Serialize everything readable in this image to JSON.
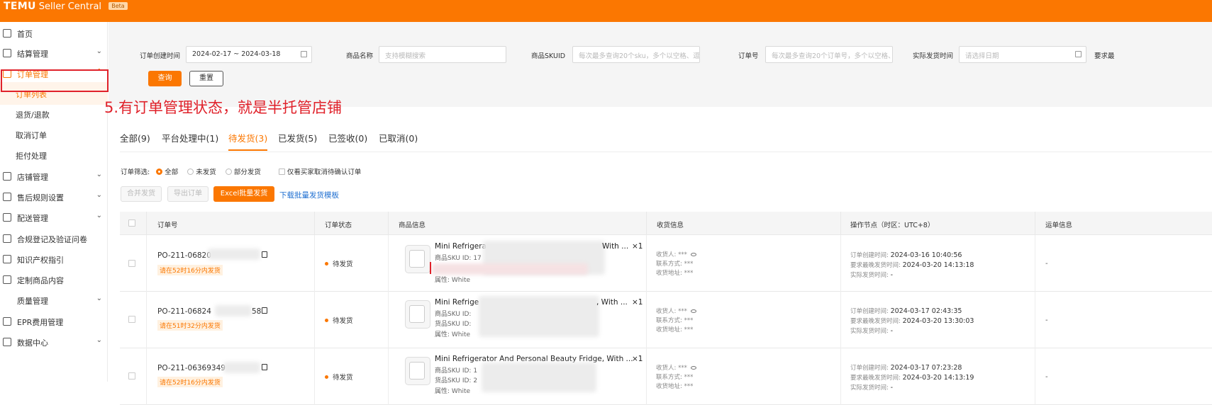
{
  "topbar": {
    "logo": "TEMU",
    "app_name": "Seller Central",
    "beta_badge": "Beta"
  },
  "sidebar": {
    "items": [
      {
        "label": "首页",
        "icon": "home-icon",
        "has_chevron": false
      },
      {
        "label": "结算管理",
        "icon": "wallet-icon",
        "has_chevron": true,
        "chevron": "⌄"
      },
      {
        "label": "订单管理",
        "icon": "order-icon",
        "has_chevron": true,
        "chevron": "⌃",
        "active": true
      },
      {
        "label": "店铺管理",
        "icon": "store-icon",
        "has_chevron": true,
        "chevron": "⌄"
      },
      {
        "label": "售后规则设置",
        "icon": "aftersale-icon",
        "has_chevron": true,
        "chevron": "⌄"
      },
      {
        "label": "配送管理",
        "icon": "truck-icon",
        "has_chevron": true,
        "chevron": "⌄"
      },
      {
        "label": "合规登记及验证问卷",
        "icon": "compliance-icon",
        "has_chevron": false
      },
      {
        "label": "知识产权指引",
        "icon": "ip-icon",
        "has_chevron": false
      },
      {
        "label": "定制商品内容",
        "icon": "custom-icon",
        "has_chevron": false
      },
      {
        "label": "质量管理",
        "icon": "",
        "has_chevron": true,
        "chevron": "⌄"
      },
      {
        "label": "EPR费用管理",
        "icon": "epr-icon",
        "has_chevron": false
      },
      {
        "label": "数据中心",
        "icon": "data-icon",
        "has_chevron": true,
        "chevron": "⌄"
      }
    ],
    "subitems": [
      {
        "label": "订单列表",
        "active": true
      },
      {
        "label": "退货/退款"
      },
      {
        "label": "取消订单"
      },
      {
        "label": "拒付处理"
      }
    ]
  },
  "filters": {
    "create_time_label": "订单创建时间",
    "create_time_value": "2024-02-17 ~ 2024-03-18",
    "product_name_label": "商品名称",
    "product_name_placeholder": "支持模糊搜索",
    "sku_label": "商品SKUID",
    "sku_placeholder": "每次最多查询20个sku，多个以空格、逗号",
    "order_no_label": "订单号",
    "order_no_placeholder": "每次最多查询20个订单号，多个以空格、逗",
    "ship_time_label": "实际发货时间",
    "ship_time_placeholder": "请选择日期",
    "extra_label": "要求最",
    "query_button": "查询",
    "reset_button": "重置"
  },
  "annotation": "5.有订单管理状态，就是半托管店铺",
  "tabs": [
    {
      "label": "全部(9)"
    },
    {
      "label": "平台处理中(1)"
    },
    {
      "label": "待发货(3)",
      "active": true
    },
    {
      "label": "已发货(5)"
    },
    {
      "label": "已签收(0)"
    },
    {
      "label": "已取消(0)"
    }
  ],
  "order_filter": {
    "label": "订单筛选:",
    "options": [
      "全部",
      "未发货",
      "部分发货"
    ],
    "selected": "全部",
    "checkbox_label": "仅看买家取消待确认订单"
  },
  "actions": {
    "merge_ship": "合并发货",
    "export": "导出订单",
    "excel_ship": "Excel批量发货",
    "download_template": "下载批量发货模板"
  },
  "table": {
    "headers": [
      "订单号",
      "订单状态",
      "商品信息",
      "收货信息",
      "操作节点（时区：UTC+8）",
      "运单信息"
    ],
    "rows": [
      {
        "order_no": "PO-211-06820",
        "deadline": "请在52时16分内发货",
        "status": "待发货",
        "product": "Mini Refrigera",
        "product_tail": "With ...",
        "qty": "×1",
        "sku_label": "商品SKU ID:",
        "sku_partial": "17",
        "attr": "属性: White",
        "receiver": "收货人: ***",
        "contact": "联系方式: ***",
        "address": "收货地址: ***",
        "op_create_label": "订单创建时间:",
        "op_create": "2024-03-16 10:40:56",
        "op_deadline_label": "要求最晚发货时间:",
        "op_deadline": "2024-03-20 14:13:18",
        "op_shipped_label": "实际发货时间:",
        "op_shipped": "-",
        "waybill": "-"
      },
      {
        "order_no": "PO-211-06824",
        "order_no_tail": "58",
        "deadline": "请在51时32分内发货",
        "status": "待发货",
        "product": "Mini Refrige",
        "product_tail": ", With ...",
        "qty": "×1",
        "sku_label": "商品SKU ID:",
        "goods_sku_label": "货品SKU ID:",
        "attr": "属性: White",
        "receiver": "收货人: ***",
        "contact": "联系方式: ***",
        "address": "收货地址: ***",
        "op_create_label": "订单创建时间:",
        "op_create": "2024-03-17 02:43:35",
        "op_deadline_label": "要求最晚发货时间:",
        "op_deadline": "2024-03-20 13:30:03",
        "op_shipped_label": "实际发货时间:",
        "op_shipped": "-",
        "waybill": "-"
      },
      {
        "order_no": "PO-211-06369349",
        "deadline": "请在52时16分内发货",
        "status": "待发货",
        "product": "Mini Refrigerator And Personal Beauty Fridge, With ...",
        "qty": "×1",
        "sku_label": "商品SKU ID:",
        "sku_partial": "1",
        "goods_sku_label": "货品SKU ID:",
        "goods_sku_partial": "2",
        "attr": "属性: White",
        "receiver": "收货人: ***",
        "contact": "联系方式: ***",
        "address": "收货地址: ***",
        "op_create_label": "订单创建时间:",
        "op_create": "2024-03-17 07:23:28",
        "op_deadline_label": "要求最晚发货时间:",
        "op_deadline": "2024-03-20 14:13:19",
        "op_shipped_label": "实际发货时间:",
        "op_shipped": "-",
        "waybill": "-"
      }
    ]
  },
  "colors": {
    "brand": "#fb7701",
    "annotation_red": "#e0212a",
    "link_blue": "#1f6fd1"
  }
}
